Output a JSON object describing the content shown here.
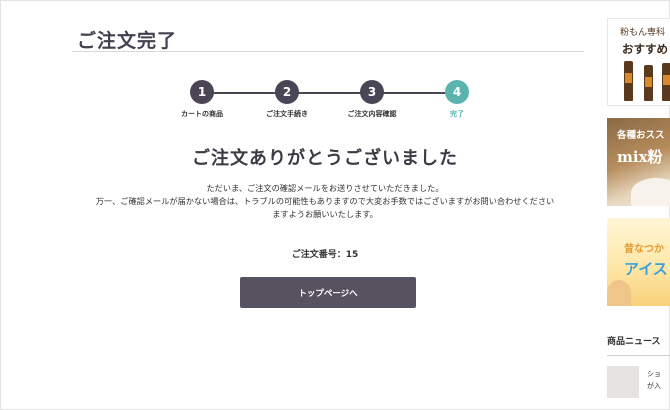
{
  "page": {
    "title": "ご注文完了"
  },
  "steps": [
    {
      "number": "1",
      "label": "カートの商品",
      "state": "done"
    },
    {
      "number": "2",
      "label": "ご注文手続き",
      "state": "done"
    },
    {
      "number": "3",
      "label": "ご注文内容確認",
      "state": "done"
    },
    {
      "number": "4",
      "label": "完了",
      "state": "current"
    }
  ],
  "complete": {
    "heading": "ご注文ありがとうございました",
    "message_lines": [
      "ただいま、ご注文の確認メールをお送りさせていただきました。",
      "万一、ご確認メールが届かない場合は、トラブルの可能性もありますので大変お手数ではございますがお問い合わせください",
      "ますようお願いいたします。"
    ],
    "order_number": "ご注文番号：15",
    "top_button_label": "トップページへ"
  },
  "sidebar": {
    "banners": [
      {
        "line1": "粉もん専科",
        "line2": "おすすめ"
      },
      {
        "line1": "各種おスス",
        "line2": "mix粉"
      },
      {
        "line1": "昔なつか",
        "line2": "アイス"
      }
    ],
    "news": {
      "heading": "商品ニュース",
      "items": [
        {
          "text_line1": "ショ",
          "text_line2": "が入"
        }
      ]
    }
  },
  "colors": {
    "accent": "#5ab4ad",
    "step_dark": "#4a4656",
    "button": "#57525f",
    "title": "#44404f"
  }
}
